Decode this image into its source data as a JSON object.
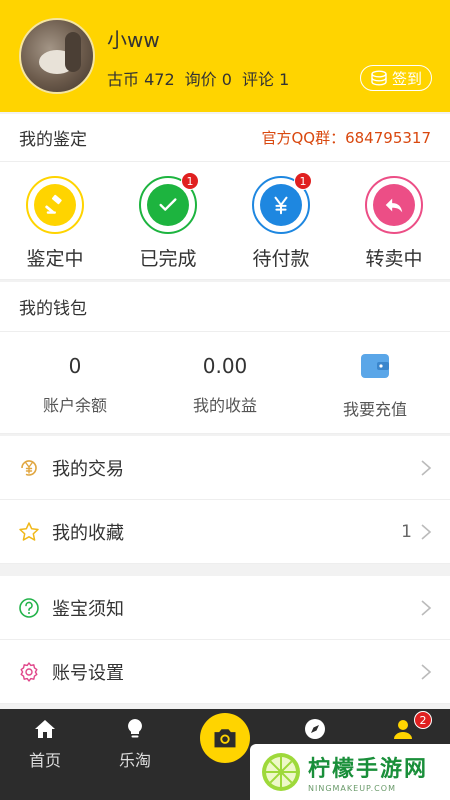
{
  "profile": {
    "username": "小ww",
    "stats": {
      "coins_label": "古币",
      "coins_value": "472",
      "inquiry_label": "询价",
      "inquiry_value": "0",
      "comment_label": "评论",
      "comment_value": "1"
    },
    "signin_label": "签到"
  },
  "appraisal": {
    "title": "我的鉴定",
    "qq_group": "官方QQ群：684795317",
    "items": [
      {
        "label": "鉴定中",
        "icon": "gavel-icon",
        "color": "#ffd400",
        "badge": ""
      },
      {
        "label": "已完成",
        "icon": "check-icon",
        "color": "#1db43f",
        "badge": "1"
      },
      {
        "label": "待付款",
        "icon": "yuan-icon",
        "color": "#1e87e0",
        "badge": "1"
      },
      {
        "label": "转卖中",
        "icon": "undo-arrow-icon",
        "color": "#ec4e86",
        "badge": ""
      }
    ]
  },
  "wallet": {
    "title": "我的钱包",
    "balance_value": "0",
    "balance_label": "账户余额",
    "earnings_value": "0.00",
    "earnings_label": "我的收益",
    "recharge_label": "我要充值"
  },
  "menu": {
    "trades_label": "我的交易",
    "favorites_label": "我的收藏",
    "favorites_count": "1",
    "notice_label": "鉴宝须知",
    "settings_label": "账号设置"
  },
  "tabbar": {
    "home_label": "首页",
    "letao_label": "乐淘",
    "profile_badge": "2"
  },
  "watermark": {
    "main": "柠檬手游网",
    "sub": "NINGMAKEUP.COM"
  },
  "colors": {
    "brand_yellow": "#ffd400",
    "qq_red": "#d9480f",
    "tabbar_bg": "#2c2c2c"
  }
}
